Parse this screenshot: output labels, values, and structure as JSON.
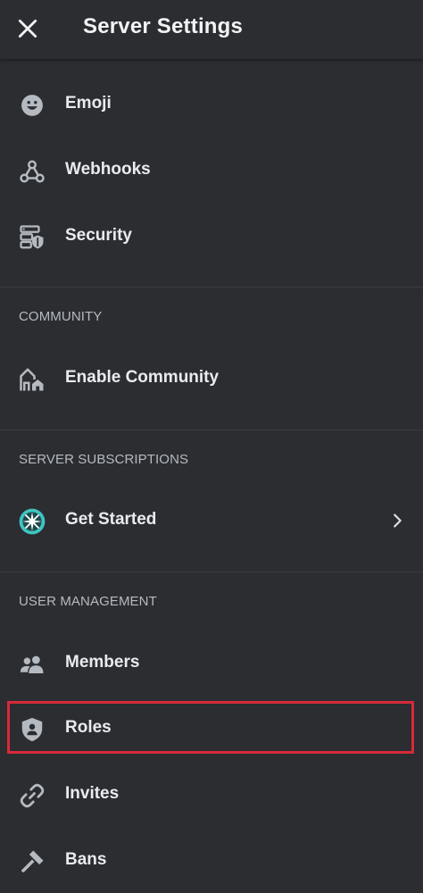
{
  "header": {
    "title": "Server Settings",
    "close_icon": "close-icon"
  },
  "items_top": [
    {
      "label": "Emoji",
      "icon": "emoji-icon"
    },
    {
      "label": "Webhooks",
      "icon": "webhooks-icon"
    },
    {
      "label": "Security",
      "icon": "security-icon"
    }
  ],
  "community": {
    "section_label": "COMMUNITY",
    "items": [
      {
        "label": "Enable Community",
        "icon": "community-icon"
      }
    ]
  },
  "subscriptions": {
    "section_label": "SERVER SUBSCRIPTIONS",
    "items": [
      {
        "label": "Get Started",
        "icon": "subscriptions-star-icon"
      }
    ]
  },
  "user_management": {
    "section_label": "USER MANAGEMENT",
    "items": [
      {
        "label": "Members",
        "icon": "members-icon"
      },
      {
        "label": "Roles",
        "icon": "roles-shield-icon",
        "highlighted": true
      },
      {
        "label": "Invites",
        "icon": "invites-link-icon"
      },
      {
        "label": "Bans",
        "icon": "bans-hammer-icon"
      }
    ]
  },
  "colors": {
    "background": "#2b2d31",
    "text": "#f2f3f5",
    "section_text": "#b5bac1",
    "icon": "#b5bac1",
    "highlight_border": "#d62a3a",
    "subscriptions_accent": "#3fc5c0"
  }
}
